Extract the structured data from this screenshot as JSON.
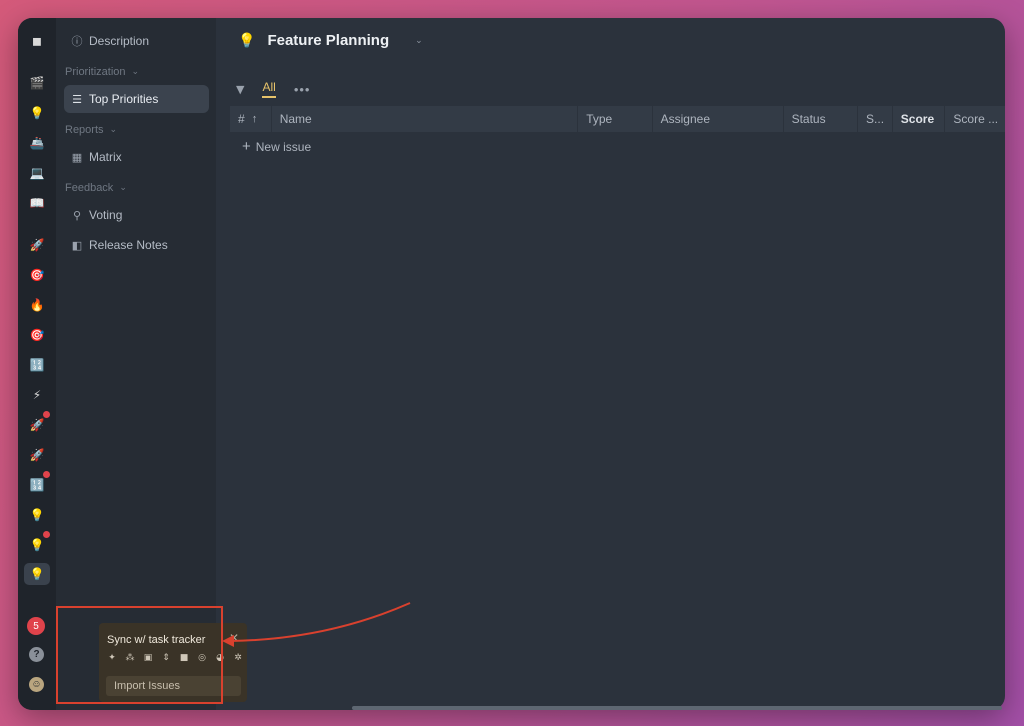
{
  "header": {
    "title": "Feature Planning",
    "title_icon": "lightbulb-icon",
    "title_chevron": "⌄"
  },
  "rail": {
    "icons": [
      {
        "name": "app-logo-icon",
        "glyph": "◼"
      },
      {
        "name": "clapper-icon",
        "glyph": "🎬"
      },
      {
        "name": "lightbulb-icon",
        "glyph": "💡"
      },
      {
        "name": "ship-icon",
        "glyph": "🚢"
      },
      {
        "name": "laptop-icon",
        "glyph": "💻"
      },
      {
        "name": "book-icon",
        "glyph": "📖"
      },
      {
        "name": "rocket-icon",
        "glyph": "🚀"
      },
      {
        "name": "target-icon",
        "glyph": "🎯"
      },
      {
        "name": "fire-icon",
        "glyph": "🔥"
      },
      {
        "name": "target-icon",
        "glyph": "🎯"
      },
      {
        "name": "numbers-icon",
        "glyph": "🔢"
      },
      {
        "name": "lightning-icon",
        "glyph": "⚡"
      },
      {
        "name": "rocket-icon",
        "glyph": "🚀"
      },
      {
        "name": "rocket-icon",
        "glyph": "🚀"
      },
      {
        "name": "numbers-icon",
        "glyph": "🔢"
      },
      {
        "name": "lightbulb-icon",
        "glyph": "💡"
      },
      {
        "name": "lightbulb-icon",
        "glyph": "💡"
      },
      {
        "name": "lightbulb-icon",
        "glyph": "💡"
      }
    ],
    "notification_count": "5",
    "help_glyph": "?",
    "avatar_glyph": "☺"
  },
  "sidebar": {
    "description": {
      "label": "Description",
      "icon": "info-icon",
      "glyph": "ⓘ"
    },
    "sections": [
      {
        "title": "Prioritization",
        "items": [
          {
            "label": "Top Priorities",
            "icon": "list-icon",
            "glyph": "☰",
            "active": true
          }
        ]
      },
      {
        "title": "Reports",
        "items": [
          {
            "label": "Matrix",
            "icon": "grid-icon",
            "glyph": "▦"
          }
        ]
      },
      {
        "title": "Feedback",
        "items": [
          {
            "label": "Voting",
            "icon": "pin-icon",
            "glyph": "⚲"
          },
          {
            "label": "Release Notes",
            "icon": "notes-icon",
            "glyph": "◧"
          }
        ]
      }
    ]
  },
  "view_bar": {
    "filter_glyph": "▼",
    "tab_all": "All",
    "more_glyph": "•••"
  },
  "table": {
    "columns": [
      "#",
      "Name",
      "Type",
      "Assignee",
      "Status",
      "S...",
      "Score",
      "Score ..."
    ],
    "sort_glyph": "↑",
    "new_issue_label": "New issue",
    "new_issue_glyph": "+"
  },
  "sync_card": {
    "title": "Sync w/ task tracker",
    "close_glyph": "✕",
    "integrations": [
      {
        "name": "pin-integration-icon",
        "glyph": "✦"
      },
      {
        "name": "asana-integration-icon",
        "glyph": "⁂"
      },
      {
        "name": "trello-integration-icon",
        "glyph": "▣"
      },
      {
        "name": "sync-integration-icon",
        "glyph": "⇕"
      },
      {
        "name": "board-integration-icon",
        "glyph": "■"
      },
      {
        "name": "github-integration-icon",
        "glyph": "◎"
      },
      {
        "name": "pie-integration-icon",
        "glyph": "◕"
      },
      {
        "name": "gear-integration-icon",
        "glyph": "✲"
      }
    ],
    "import_label": "Import Issues"
  },
  "colors": {
    "accent_yellow": "#e7c36a",
    "annotation_red": "#d9412e",
    "badge_red": "#e0434b"
  }
}
